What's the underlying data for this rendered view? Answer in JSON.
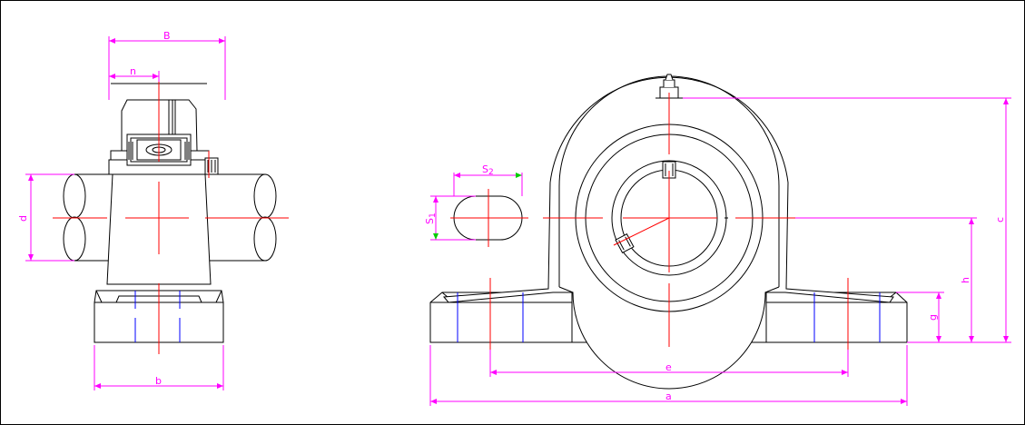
{
  "drawing": {
    "line_color": "#000000",
    "centerline_color": "#ff0000",
    "dimension_color": "#ff00ff",
    "hidden_hole_color": "#0000ff"
  },
  "labels": {
    "B": "B",
    "n": "n",
    "d": "d",
    "b": "b",
    "S2_main": "S",
    "S2_sub": "2",
    "S1_main": "S",
    "S1_sub": "1",
    "c": "c",
    "h": "h",
    "g": "g",
    "e": "e",
    "a": "a"
  }
}
